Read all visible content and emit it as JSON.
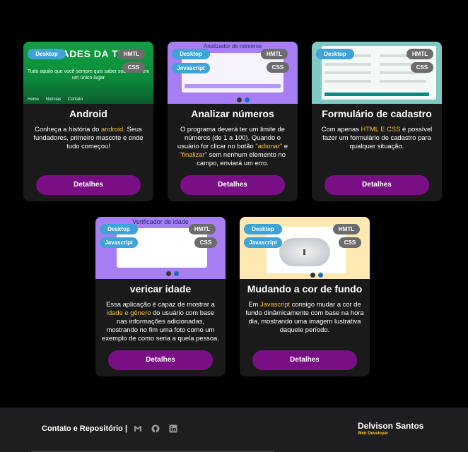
{
  "colors": {
    "background": "#000000",
    "card": "#1a1a1b",
    "button": "#7a0f85",
    "highlight": "#f2c230",
    "badge_blue": "#3fa3d8",
    "badge_gray": "#6c6c6c",
    "footer": "#1e1e20"
  },
  "cards": [
    {
      "title": "Android",
      "badges": {
        "desktop": "Desktop",
        "html": "HMTL",
        "css": "CSS"
      },
      "thumb": {
        "heading": "DADES DA TEC",
        "subtitle": "Tudo aquilo que você sempre quis saber sobre tech em um único lugar",
        "nav": [
          "Home",
          "Notícias",
          "Contato"
        ]
      },
      "desc": {
        "p1": "Conheça a história do ",
        "h1": "android",
        "p2": ". Seus fundadores, primeiro mascote e onde tudo começou!"
      },
      "button": "Detalhes"
    },
    {
      "title": "Analizar números",
      "badges": {
        "desktop": "Desktop",
        "javascript": "Javascript",
        "html": "HMTL",
        "css": "CSS"
      },
      "thumb": {
        "heading": "Analizador de números"
      },
      "desc": {
        "p1": "O programa deverá ter um limite de números (de 1 a 100). Quando o usuário for clicar no botão ",
        "h1": "\"adionar\"",
        "p2": " e ",
        "h2": "\"finalizar\"",
        "p3": " sem nenhum elemento no campo, enviará um erro."
      },
      "button": "Detalhes"
    },
    {
      "title": "Formulário de cadastro",
      "badges": {
        "desktop": "Desktop",
        "html": "HMTL",
        "css": "CSS"
      },
      "desc": {
        "p1": "Com apenas ",
        "h1": "HTML E CSS",
        "p2": " é possível fazer um formulário de cadastro para qualquer situação."
      },
      "button": "Detalhes"
    },
    {
      "title": "vericar idade",
      "badges": {
        "desktop": "Desktop",
        "javascript": "Javascript",
        "html": "HMTL",
        "css": "CSS"
      },
      "thumb": {
        "heading": "Verificador de idade"
      },
      "desc": {
        "p1": "Essa aplicação é capaz de mostrar a ",
        "h1": "idade e gênero",
        "p2": " do usuário com base nas informações adicionadas, mostrando no fim uma foto como um exemplo de como seria a quela pessoa."
      },
      "button": "Detalhes"
    },
    {
      "title": "Mudando a cor de fundo",
      "badges": {
        "desktop": "Desktop",
        "javascript": "Javascript",
        "html": "HMTL",
        "css": "CSS"
      },
      "desc": {
        "p1": "Em ",
        "h1": "Javascript",
        "p2": " consigo mudar a cor de fundo dinâmicamente com base na hora dia, mostrando uma imagem lustrativa daquele período."
      },
      "button": "Detalhes"
    }
  ],
  "footer": {
    "contact": "Contato e Repositório |",
    "icons": [
      "gmail-icon",
      "github-icon",
      "linkedin-icon"
    ],
    "name": "Delvison Santos",
    "role": "Web Developer"
  }
}
